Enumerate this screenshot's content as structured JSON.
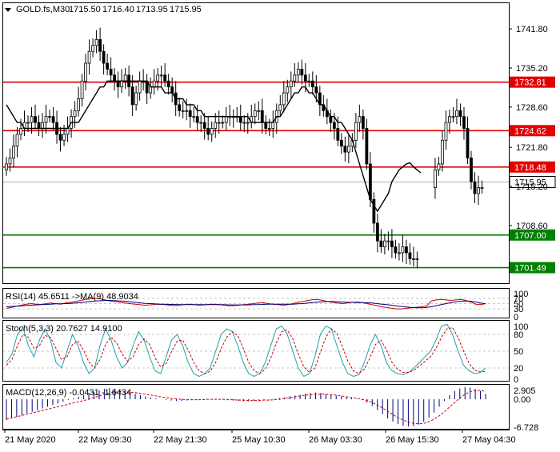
{
  "header": {
    "symbol": "GOLD.fs,M30",
    "prices": [
      "1715.50",
      "1716.40",
      "1713.95",
      "1715.95"
    ]
  },
  "colors": {
    "red_level": "#e00000",
    "green_level": "#008000",
    "ma": "#000000",
    "rsi": "#cc0000",
    "rsi_ma": "#000080",
    "stoch_main": "#20a0b0",
    "stoch_signal": "#cc0000",
    "macd_hist": "#000080",
    "macd_signal": "#cc0000",
    "candle": "#000000"
  },
  "chart_data": [
    {
      "type": "candlestick",
      "ylim": [
        1699,
        1746
      ],
      "price_ticks": [
        "1741.80",
        "1735.20",
        "1728.60",
        "1721.80",
        "1715.20",
        "1708.60"
      ],
      "price_tick_values": [
        1741.8,
        1735.2,
        1728.6,
        1721.8,
        1715.2,
        1708.6
      ],
      "levels": [
        {
          "value": 1732.81,
          "label": "1732.81",
          "color": "red"
        },
        {
          "value": 1724.62,
          "label": "1724.62",
          "color": "red"
        },
        {
          "value": 1718.48,
          "label": "1718.48",
          "color": "red"
        },
        {
          "value": 1707.0,
          "label": "1707.00",
          "color": "green"
        },
        {
          "value": 1701.49,
          "label": "1701.49",
          "color": "green"
        }
      ],
      "current_price": {
        "value": 1715.95,
        "label": "1715.95"
      },
      "x_labels": [
        "21 May 2020",
        "22 May 09:30",
        "22 May 21:30",
        "25 May 10:30",
        "26 May 03:30",
        "26 May 15:30",
        "27 May 04:30"
      ],
      "close": [
        1719,
        1720,
        1722,
        1724,
        1725,
        1726,
        1726,
        1727,
        1726,
        1725,
        1726,
        1727,
        1727,
        1726,
        1724,
        1723,
        1724,
        1725,
        1727,
        1728,
        1730,
        1733,
        1736,
        1738,
        1739,
        1740,
        1738,
        1736,
        1735,
        1734,
        1733,
        1732,
        1733,
        1734,
        1732,
        1729,
        1731,
        1733,
        1733,
        1731,
        1732,
        1733,
        1734,
        1734,
        1733,
        1732,
        1731,
        1729,
        1728,
        1728,
        1728,
        1727,
        1727,
        1726,
        1726,
        1725,
        1724,
        1725,
        1726,
        1726,
        1726,
        1727,
        1727,
        1727,
        1727,
        1726,
        1726,
        1726,
        1727,
        1728,
        1728,
        1726,
        1725,
        1725,
        1726,
        1728,
        1729,
        1731,
        1732,
        1733,
        1734,
        1735,
        1734,
        1733,
        1733,
        1732,
        1731,
        1729,
        1728,
        1727,
        1726,
        1725,
        1723,
        1722,
        1721,
        1722,
        1723,
        1726,
        1727,
        1725,
        1719,
        1713,
        1709,
        1706,
        1705,
        1706,
        1706,
        1705,
        1704,
        1704,
        1705,
        1704,
        1703,
        1703,
        1703,
        1701,
        1702,
        1704,
        1715,
        1718,
        1719,
        1723,
        1726,
        1727,
        1727,
        1728,
        1727,
        1725,
        1720,
        1716,
        1714,
        1715,
        1715
      ],
      "ma": [
        1729,
        1728,
        1727,
        1726,
        1726,
        1725,
        1725,
        1725,
        1725,
        1725,
        1725,
        1725,
        1725,
        1725,
        1725,
        1725,
        1725,
        1725,
        1726,
        1726,
        1726,
        1727,
        1728,
        1729,
        1730,
        1731,
        1732,
        1732,
        1733,
        1733,
        1733,
        1733,
        1733,
        1733,
        1733,
        1733,
        1733,
        1733,
        1733,
        1733,
        1732,
        1732,
        1732,
        1732,
        1731,
        1731,
        1731,
        1730,
        1730,
        1730,
        1729,
        1729,
        1729,
        1728,
        1728,
        1727,
        1727,
        1727,
        1727,
        1727,
        1727,
        1727,
        1727,
        1727,
        1727,
        1727,
        1727,
        1727,
        1726,
        1726,
        1726,
        1726,
        1726,
        1726,
        1726,
        1727,
        1727,
        1728,
        1729,
        1730,
        1731,
        1731,
        1732,
        1732,
        1731,
        1731,
        1730,
        1729,
        1729,
        1728,
        1727,
        1727,
        1726,
        1726,
        1725,
        1724,
        1723,
        1721,
        1719,
        1717,
        1715,
        1713,
        1712,
        1711,
        1712,
        1713,
        1714,
        1716,
        1717,
        1718,
        1718.5,
        1719,
        1719.2,
        1718.5,
        1718,
        1717.5
      ],
      "ma_start": 0,
      "gap_indices": [
        115,
        116,
        117,
        118
      ]
    },
    {
      "type": "line",
      "title": "RSI(14) 45.6511 ->MA(9) 48.9034",
      "ticks": [
        "70",
        "50",
        "30",
        "0",
        "100"
      ],
      "tick_values": [
        70,
        50,
        30,
        0,
        100
      ],
      "ylim": [
        0,
        100
      ],
      "series": [
        {
          "values": [
            32,
            35,
            40,
            44,
            48,
            50,
            48,
            46,
            50,
            52,
            50,
            48,
            52,
            55,
            58,
            62,
            66,
            68,
            70,
            68,
            64,
            60,
            58,
            55,
            52,
            50,
            48,
            46,
            44,
            45,
            47,
            48,
            46,
            44,
            42,
            44,
            46,
            48,
            46,
            44,
            45,
            47,
            48,
            46,
            44,
            42,
            42,
            44,
            46,
            48,
            50,
            52,
            53,
            50,
            48,
            46,
            44,
            46,
            50,
            55,
            58,
            62,
            65,
            66,
            62,
            58,
            55,
            52,
            50,
            52,
            55,
            56,
            54,
            50,
            46,
            42,
            38,
            35,
            32,
            30,
            30,
            32,
            34,
            36,
            38,
            40,
            60,
            64,
            66,
            64,
            62,
            64,
            66,
            62,
            56,
            48,
            46,
            50
          ]
        },
        {
          "values": [
            38,
            39,
            40,
            41,
            43,
            44,
            45,
            46,
            47,
            48,
            49,
            49,
            50,
            51,
            52,
            54,
            56,
            58,
            60,
            61,
            62,
            62,
            61,
            60,
            59,
            57,
            55,
            53,
            51,
            50,
            49,
            48,
            48,
            47,
            47,
            46,
            46,
            46,
            46,
            46,
            46,
            46,
            46,
            46,
            46,
            45,
            45,
            45,
            45,
            45,
            46,
            46,
            47,
            48,
            48,
            48,
            48,
            48,
            48,
            49,
            50,
            52,
            54,
            56,
            57,
            58,
            58,
            57,
            56,
            55,
            55,
            54,
            54,
            53,
            52,
            50,
            48,
            46,
            44,
            41,
            39,
            37,
            35,
            34,
            34,
            35,
            38,
            42,
            46,
            50,
            54,
            57,
            59,
            60,
            59,
            56,
            52,
            49
          ]
        }
      ]
    },
    {
      "type": "line",
      "title": "Stoch(5,3,3) 20.7627 14.9100",
      "ticks": [
        "100",
        "80",
        "50",
        "20",
        "0"
      ],
      "tick_values": [
        100,
        80,
        50,
        20,
        0
      ],
      "ylim": [
        0,
        100
      ],
      "series": [
        {
          "values": [
            30,
            45,
            80,
            92,
            60,
            40,
            70,
            90,
            70,
            30,
            20,
            50,
            80,
            60,
            30,
            10,
            20,
            60,
            90,
            70,
            40,
            20,
            30,
            60,
            85,
            70,
            40,
            15,
            10,
            40,
            70,
            80,
            60,
            30,
            10,
            5,
            10,
            20,
            50,
            80,
            90,
            85,
            60,
            30,
            10,
            5,
            10,
            30,
            60,
            90,
            95,
            80,
            50,
            20,
            5,
            10,
            40,
            80,
            95,
            90,
            60,
            30,
            10,
            5,
            8,
            30,
            60,
            80,
            60,
            30,
            15,
            10,
            8,
            12,
            20,
            30,
            40,
            50,
            70,
            95,
            98,
            80,
            50,
            25,
            15,
            10,
            12,
            20
          ]
        },
        {
          "values": [
            25,
            35,
            60,
            80,
            75,
            55,
            60,
            78,
            75,
            55,
            35,
            40,
            62,
            68,
            52,
            30,
            20,
            35,
            62,
            75,
            65,
            45,
            32,
            40,
            62,
            72,
            62,
            38,
            22,
            28,
            50,
            68,
            70,
            52,
            30,
            15,
            10,
            14,
            30,
            55,
            75,
            85,
            78,
            55,
            30,
            15,
            10,
            18,
            38,
            65,
            85,
            88,
            72,
            45,
            22,
            12,
            20,
            48,
            75,
            90,
            82,
            58,
            32,
            15,
            10,
            18,
            38,
            62,
            70,
            52,
            30,
            18,
            12,
            12,
            16,
            24,
            32,
            40,
            55,
            75,
            90,
            92,
            75,
            50,
            28,
            16,
            13,
            14
          ]
        }
      ]
    },
    {
      "type": "bar",
      "title": "MACD(12,26,9) -0.0431 -1.6434",
      "ticks": [
        "2.905",
        "0.00",
        "-6.728"
      ],
      "tick_values": [
        2.905,
        0,
        -6.728
      ],
      "ylim": [
        -6.728,
        2.905
      ],
      "histogram": [
        -5,
        -4.6,
        -4.2,
        -3.8,
        -3.4,
        -3,
        -2.6,
        -2.2,
        -1.8,
        -1.4,
        -1,
        -0.6,
        -0.2,
        0.2,
        0.6,
        1,
        1.4,
        1.8,
        2.2,
        2.5,
        2.7,
        2.5,
        2.2,
        1.9,
        1.6,
        1.3,
        1,
        0.7,
        0.4,
        0.2,
        0,
        -0.2,
        -0.3,
        -0.4,
        -0.4,
        -0.3,
        -0.2,
        -0.1,
        0,
        0.1,
        0.1,
        0,
        -0.1,
        -0.2,
        -0.3,
        -0.4,
        -0.5,
        -0.5,
        -0.4,
        -0.3,
        -0.2,
        -0.1,
        0.1,
        0.3,
        0.5,
        0.7,
        0.9,
        1.1,
        1.3,
        1.5,
        1.6,
        1.5,
        1.3,
        1.1,
        0.9,
        0.7,
        0.5,
        0.3,
        0.1,
        -0.2,
        -0.8,
        -1.6,
        -2.6,
        -3.6,
        -4.6,
        -5.4,
        -6,
        -6.4,
        -6.6,
        -6.5,
        -6.1,
        -5.4,
        -4.4,
        -3.2,
        -1.8,
        -0.4,
        1,
        2,
        2.6,
        2.9,
        2.8,
        2.5,
        2,
        1.3
      ],
      "signal": [
        -4.8,
        -4.5,
        -4.2,
        -3.9,
        -3.6,
        -3.3,
        -3,
        -2.7,
        -2.4,
        -2.1,
        -1.8,
        -1.5,
        -1.2,
        -0.9,
        -0.6,
        -0.3,
        0,
        0.4,
        0.8,
        1.2,
        1.5,
        1.7,
        1.8,
        1.8,
        1.7,
        1.6,
        1.4,
        1.2,
        1,
        0.8,
        0.6,
        0.4,
        0.2,
        0.1,
        0,
        -0.1,
        -0.1,
        -0.1,
        -0.1,
        0,
        0,
        0,
        0,
        -0.1,
        -0.1,
        -0.2,
        -0.2,
        -0.3,
        -0.3,
        -0.3,
        -0.2,
        -0.2,
        -0.1,
        0,
        0.2,
        0.4,
        0.6,
        0.8,
        1,
        1.1,
        1.2,
        1.2,
        1.2,
        1.1,
        1,
        0.8,
        0.6,
        0.4,
        0.2,
        0,
        -0.3,
        -0.8,
        -1.4,
        -2.1,
        -2.9,
        -3.7,
        -4.4,
        -5,
        -5.5,
        -5.8,
        -5.9,
        -5.8,
        -5.4,
        -4.8,
        -4,
        -3,
        -1.9,
        -0.8,
        0.3,
        1.2,
        1.8,
        2.1,
        2.1,
        1.9
      ]
    }
  ]
}
